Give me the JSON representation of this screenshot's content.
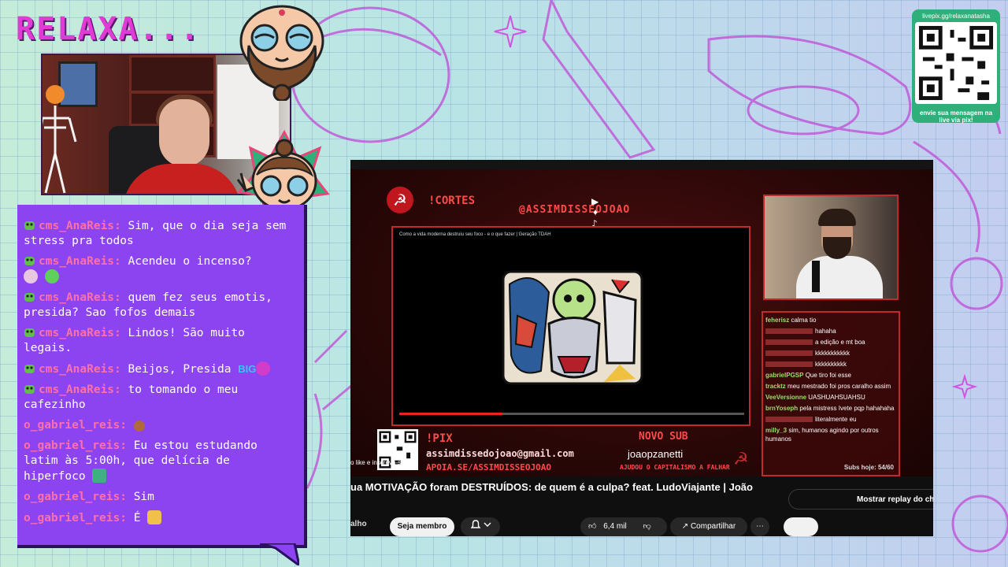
{
  "overlay": {
    "title": "RELAXA...",
    "accent_pink": "#e03bd4",
    "chat_purple": "#8c44f0"
  },
  "qr_card": {
    "top_text": "livepix.gg/relaxanatasha",
    "bottom_text": "envie sua mensagem na live via pix!"
  },
  "chat": {
    "messages": [
      {
        "user": "cms_AnaReis:",
        "text": "Sim, que o dia seja sem stress pra todos"
      },
      {
        "user": "cms_AnaReis:",
        "text": "Acendeu o incenso?"
      },
      {
        "user": "cms_AnaReis:",
        "text": "quem fez seus emotis, presida? Sao fofos demais"
      },
      {
        "user": "cms_AnaReis:",
        "text": "Lindos! São muito legais."
      },
      {
        "user": "cms_AnaReis:",
        "text": "Beijos, Presida",
        "emote_text": "BIG"
      },
      {
        "user": "cms_AnaReis:",
        "text": "to tomando o meu cafezinho"
      },
      {
        "user": "o_gabriel_reis:",
        "text": ""
      },
      {
        "user": "o_gabriel_reis:",
        "text": "Eu estou estudando latim às 5:00h, que delícia de hiperfoco"
      },
      {
        "user": "o_gabriel_reis:",
        "text": "Sim"
      },
      {
        "user": "o_gabriel_reis:",
        "text": "É"
      }
    ]
  },
  "shared_video": {
    "cortes_label": "!CORTES",
    "handle": "@ASSIMDISSEOJOAO",
    "inner_video_title": "Como a vida moderna destruiu seu foco - e o que fazer | Geração TDAH",
    "pix_label": "!PIX",
    "email": "assimdissedojoao@gmail.com",
    "apoia": "APOIA.SE/ASSIMDISSEOJOAO",
    "like_text": "o like e inscreva-se!",
    "novo_sub_label": "NOVO SUB",
    "novo_sub_name": "joaopzanetti",
    "capital_text": "AJUDOU O CAPITALISMO A FALHAR",
    "mini_chat": [
      {
        "user": "feherisz",
        "text": "calma tio"
      },
      {
        "user": "",
        "text": "hahaha"
      },
      {
        "user": "",
        "text": "a edição e mt boa"
      },
      {
        "user": "",
        "text": "kkkkkkkkkkk"
      },
      {
        "user": "",
        "text": "kkkkkkkkkk"
      },
      {
        "user": "gabrielPGSP",
        "text": "Que tiro foi esse"
      },
      {
        "user": "tracktz",
        "text": "meu mestrado foi pros caralho assim"
      },
      {
        "user": "VeeVersionne",
        "text": "UASHUAHSUAHSU"
      },
      {
        "user": "brnYoseph",
        "text": "pela mistress Ivete pqp hahahaha"
      },
      {
        "user": "",
        "text": "literalmente eu"
      },
      {
        "user": "milly_3",
        "text": "sim, humanos agindo por outros humanos"
      }
    ],
    "subs_today": "Subs hoje: 54/60",
    "video_title": "ua MOTIVAÇÃO foram DESTRUÍDOS: de quem é a culpa? feat. LudoViajante | João",
    "replay_button": "Mostrar replay do chat",
    "channel_name": "alho",
    "member_button": "Seja membro",
    "like_count": "6,4 mil",
    "share_button": "Compartilhar",
    "more_button": "⋯"
  }
}
